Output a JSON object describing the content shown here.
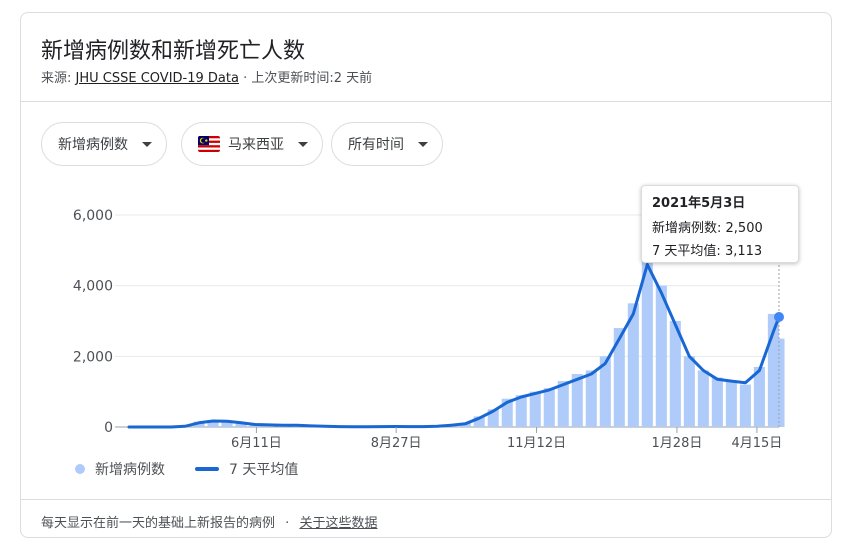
{
  "header": {
    "title": "新增病例数和新增死亡人数",
    "source_prefix": "来源:",
    "source_link": "JHU CSSE COVID-19 Data",
    "source_sep": "·",
    "updated": "上次更新时间:2 天前"
  },
  "filters": {
    "metric": "新增病例数",
    "region": "马来西亚",
    "range": "所有时间"
  },
  "tooltip": {
    "date": "2021年5月3日",
    "cases_label": "新增病例数:",
    "cases_value": "2,500",
    "avg_label": "7 天平均值:",
    "avg_value": "3,113"
  },
  "legend": {
    "bars": "新增病例数",
    "line": "7 天平均值"
  },
  "footer": {
    "note": "每天显示在前一天的基础上新报告的病例",
    "sep": "·",
    "link": "关于这些数据"
  },
  "colors": {
    "bar": "#aecbfa",
    "line": "#1967d2",
    "dot": "#4285f4",
    "flag_red": "#cc0001",
    "flag_blue": "#010066",
    "flag_yellow": "#ffcc00"
  },
  "chart_data": {
    "type": "bar",
    "title": "",
    "xlabel": "",
    "ylabel": "",
    "ylim": [
      0,
      6000
    ],
    "yticks": [
      0,
      2000,
      4000,
      6000
    ],
    "ytick_labels": [
      "0",
      "2,000",
      "4,000",
      "6,000"
    ],
    "xticks": [
      "6月11日",
      "8月27日",
      "11月12日",
      "1月28日",
      "4月15日"
    ],
    "x_start": "2020-01-25",
    "x_end": "2021-05-03",
    "grid": true,
    "legend_position": "bottom-left",
    "series": [
      {
        "name": "新增病例数",
        "kind": "bar",
        "description": "daily new cases (points approximate, 10-day resolution)",
        "x": [
          "2020-01-25",
          "2020-02-04",
          "2020-02-14",
          "2020-02-24",
          "2020-03-05",
          "2020-03-15",
          "2020-03-25",
          "2020-04-04",
          "2020-04-14",
          "2020-04-24",
          "2020-05-04",
          "2020-05-14",
          "2020-05-24",
          "2020-06-03",
          "2020-06-13",
          "2020-06-23",
          "2020-07-03",
          "2020-07-13",
          "2020-07-23",
          "2020-08-02",
          "2020-08-12",
          "2020-08-22",
          "2020-09-01",
          "2020-09-11",
          "2020-09-21",
          "2020-10-01",
          "2020-10-11",
          "2020-10-21",
          "2020-10-31",
          "2020-11-10",
          "2020-11-20",
          "2020-11-30",
          "2020-12-10",
          "2020-12-20",
          "2020-12-30",
          "2021-01-09",
          "2021-01-19",
          "2021-01-29",
          "2021-02-08",
          "2021-02-18",
          "2021-02-28",
          "2021-03-10",
          "2021-03-20",
          "2021-03-30",
          "2021-04-09",
          "2021-04-19",
          "2021-04-29",
          "2021-05-03"
        ],
        "values": [
          0,
          0,
          0,
          0,
          30,
          150,
          200,
          170,
          130,
          60,
          60,
          40,
          80,
          25,
          20,
          10,
          8,
          10,
          15,
          20,
          15,
          10,
          30,
          60,
          100,
          300,
          500,
          800,
          900,
          1000,
          1100,
          1300,
          1500,
          1600,
          2000,
          2800,
          3500,
          5700,
          4000,
          3000,
          2000,
          1600,
          1400,
          1300,
          1200,
          1700,
          3200,
          2500
        ]
      },
      {
        "name": "7 天平均值",
        "kind": "line",
        "x": [
          "2020-01-25",
          "2020-02-04",
          "2020-02-14",
          "2020-02-24",
          "2020-03-05",
          "2020-03-15",
          "2020-03-25",
          "2020-04-04",
          "2020-04-14",
          "2020-04-24",
          "2020-05-04",
          "2020-05-14",
          "2020-05-24",
          "2020-06-03",
          "2020-06-13",
          "2020-06-23",
          "2020-07-03",
          "2020-07-13",
          "2020-07-23",
          "2020-08-02",
          "2020-08-12",
          "2020-08-22",
          "2020-09-01",
          "2020-09-11",
          "2020-09-21",
          "2020-10-01",
          "2020-10-11",
          "2020-10-21",
          "2020-10-31",
          "2020-11-10",
          "2020-11-20",
          "2020-11-30",
          "2020-12-10",
          "2020-12-20",
          "2020-12-30",
          "2021-01-09",
          "2021-01-19",
          "2021-01-29",
          "2021-02-08",
          "2021-02-18",
          "2021-02-28",
          "2021-03-10",
          "2021-03-20",
          "2021-03-30",
          "2021-04-09",
          "2021-04-19",
          "2021-04-29",
          "2021-05-03"
        ],
        "values": [
          0,
          0,
          0,
          0,
          20,
          120,
          170,
          160,
          120,
          70,
          60,
          50,
          50,
          30,
          20,
          12,
          8,
          8,
          10,
          15,
          12,
          10,
          20,
          50,
          90,
          250,
          450,
          700,
          850,
          950,
          1050,
          1200,
          1350,
          1500,
          1800,
          2500,
          3200,
          4600,
          3800,
          2900,
          2000,
          1600,
          1350,
          1300,
          1250,
          1600,
          2700,
          3113
        ]
      }
    ]
  }
}
